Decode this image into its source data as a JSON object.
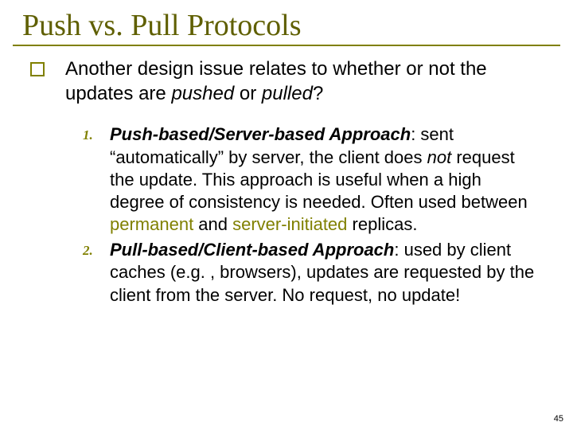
{
  "title": "Push vs. Pull Protocols",
  "intro": {
    "pre": "Another design issue relates to whether or not the updates are ",
    "em1": "pushed",
    "mid": " or ",
    "em2": "pulled",
    "post": "?"
  },
  "items": [
    {
      "num": "1.",
      "head": "Push-based/Server-based Approach",
      "t1": ": sent “automatically” by server, the client does ",
      "em1": "not",
      "t2": " request the update. This approach is useful when a high degree of consistency is needed. Often used between ",
      "kw1": "permanent",
      "t3": " and ",
      "kw2": "server-initiated",
      "t4": " replicas."
    },
    {
      "num": "2.",
      "head": "Pull-based/Client-based Approach",
      "t1": ": used by client caches (e.g. , browsers), updates are requested by the client from the server. No request, no update!",
      "em1": "",
      "t2": "",
      "kw1": "",
      "t3": "",
      "kw2": "",
      "t4": ""
    }
  ],
  "page": "45"
}
